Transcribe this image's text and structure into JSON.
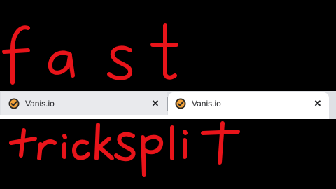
{
  "overlay": {
    "ink_color": "#e8141a",
    "background": "#000000"
  },
  "tabs": [
    {
      "title": "Vanis.io",
      "active": false,
      "favicon": "vanis-check-icon",
      "close_glyph": "✕"
    },
    {
      "title": "Vanis.io",
      "active": true,
      "favicon": "vanis-check-icon",
      "close_glyph": "✕"
    }
  ],
  "colors": {
    "tabstrip": "#dfe1e5",
    "active_tab": "#ffffff",
    "inactive_tab": "#e9eaed",
    "favicon_ring": "#2d2a26",
    "favicon_fill": "#f2a23a"
  }
}
